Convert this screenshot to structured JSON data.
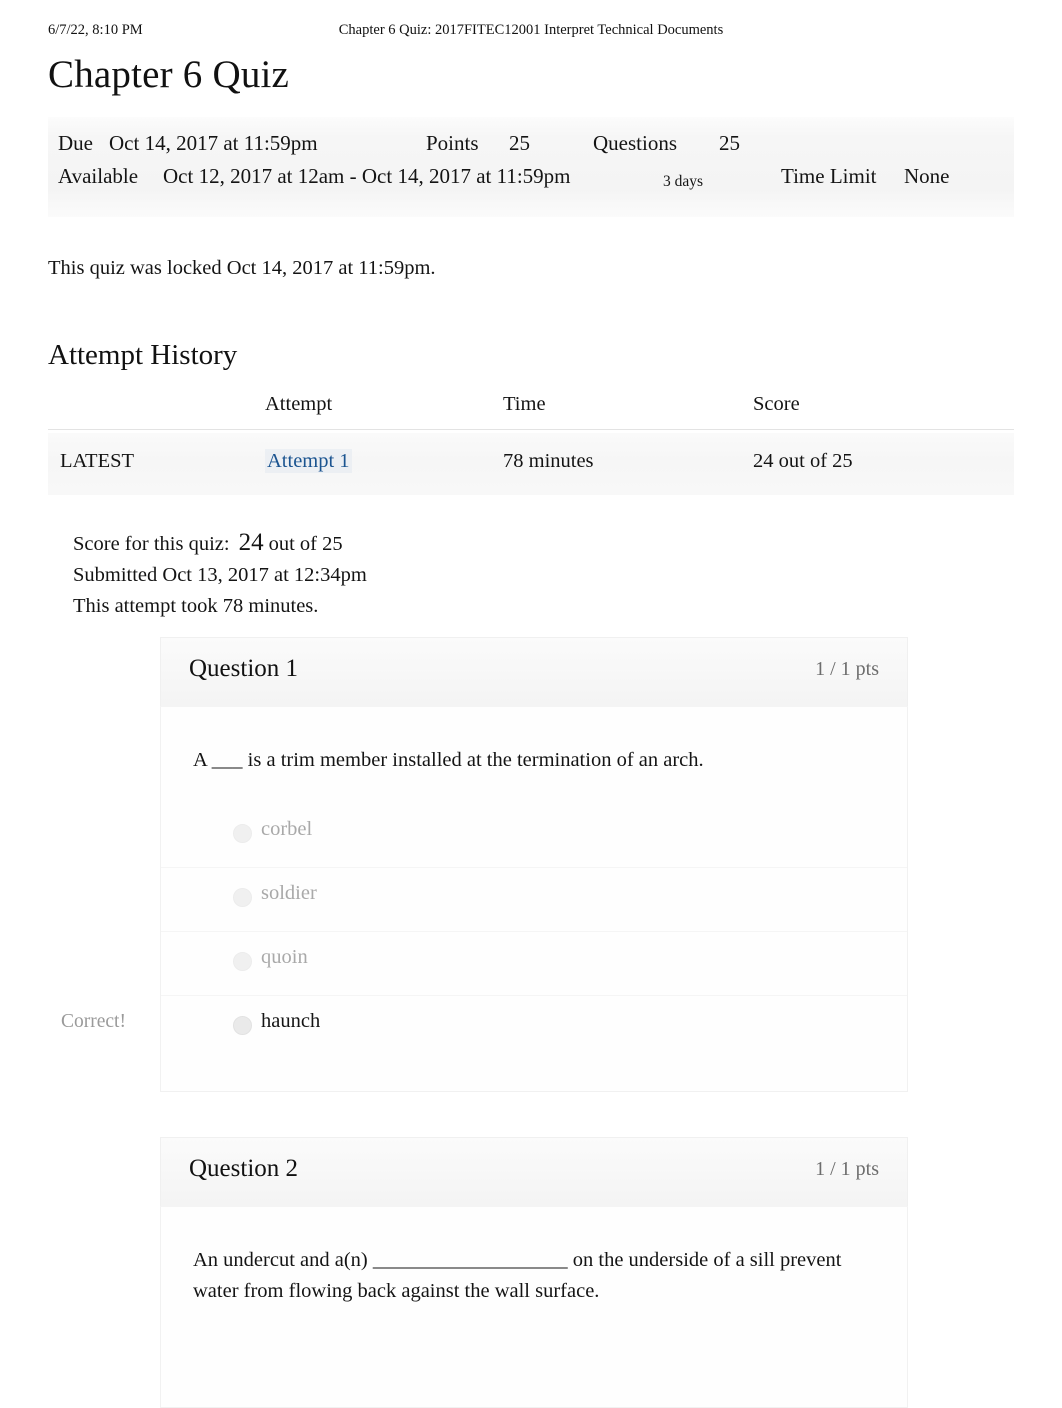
{
  "print_header": {
    "datetime": "6/7/22, 8:10 PM",
    "document_title": "Chapter 6 Quiz: 2017FITEC12001 Interpret Technical Documents"
  },
  "page_title": "Chapter 6 Quiz",
  "quiz_meta": {
    "due_label": "Due",
    "due_value": "Oct 14, 2017 at 11:59pm",
    "points_label": "Points",
    "points_value": "25",
    "questions_label": "Questions",
    "questions_value": "25",
    "available_label": "Available",
    "available_value": "Oct 12, 2017 at 12am - Oct 14, 2017 at 11:59pm",
    "duration_value": "3 days",
    "time_limit_label": "Time Limit",
    "time_limit_value": "None"
  },
  "locked_notice": "This quiz was locked Oct 14, 2017 at 11:59pm.",
  "attempt_history": {
    "title": "Attempt History",
    "columns": [
      "",
      "Attempt",
      "Time",
      "Score"
    ],
    "rows": [
      {
        "flag": "LATEST",
        "attempt": "Attempt 1",
        "time": "78 minutes",
        "score": "24 out of 25"
      }
    ]
  },
  "score_summary": {
    "score_label": "Score for this quiz:",
    "score_value": "24",
    "score_suffix": "out of 25",
    "submitted": "Submitted Oct 13, 2017 at 12:34pm",
    "duration": "This attempt took 78 minutes."
  },
  "questions": [
    {
      "title": "Question 1",
      "points": "1 / 1 pts",
      "text": "A ___ is a trim member installed at the termination of an arch.",
      "answers": [
        {
          "label": "corbel",
          "selected": false,
          "verdict": ""
        },
        {
          "label": "soldier",
          "selected": false,
          "verdict": ""
        },
        {
          "label": "quoin",
          "selected": false,
          "verdict": ""
        },
        {
          "label": "haunch",
          "selected": true,
          "verdict": "Correct!"
        }
      ]
    },
    {
      "title": "Question 2",
      "points": "1 / 1 pts",
      "text": "An undercut and a(n) ___________________ on the underside of a sill prevent water from flowing back against the wall surface.",
      "answers": []
    }
  ],
  "colors": {
    "link": "#1b5490",
    "meta_background": "#f4f4f4",
    "muted_text": "#9a9a9a"
  }
}
